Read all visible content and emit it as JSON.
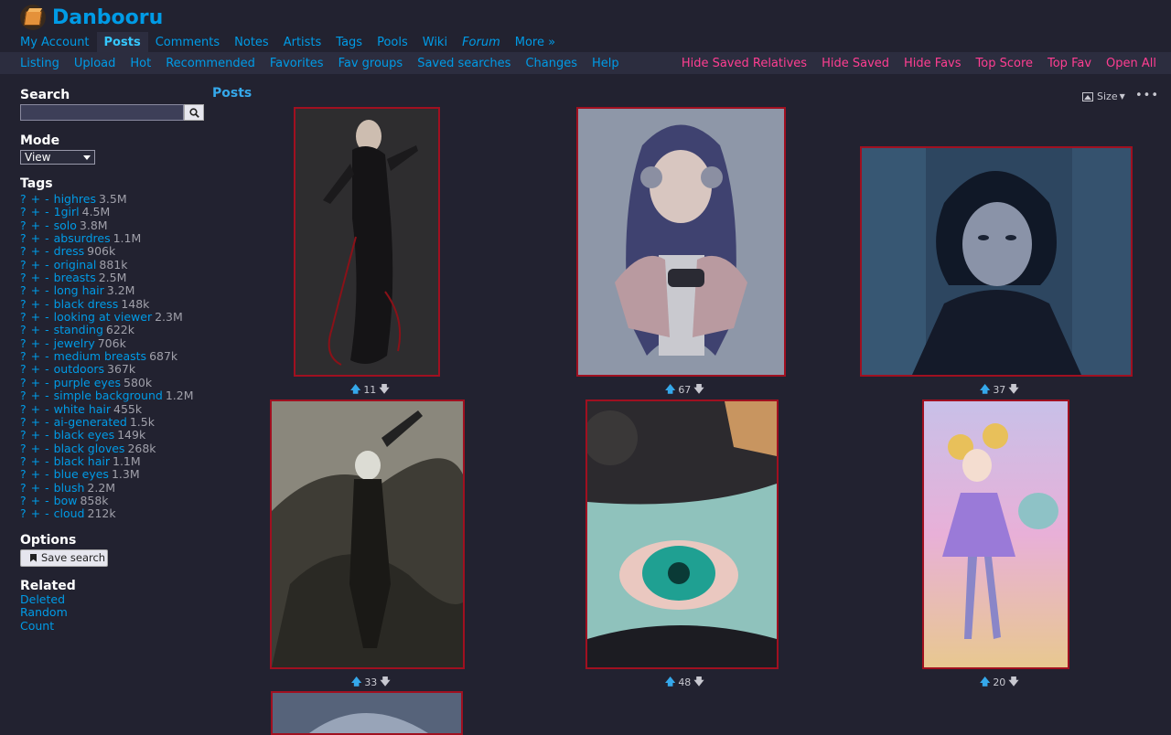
{
  "site": {
    "name": "Danbooru"
  },
  "main_menu": [
    {
      "label": "My Account"
    },
    {
      "label": "Posts",
      "active": true
    },
    {
      "label": "Comments"
    },
    {
      "label": "Notes"
    },
    {
      "label": "Artists"
    },
    {
      "label": "Tags"
    },
    {
      "label": "Pools"
    },
    {
      "label": "Wiki"
    },
    {
      "label": "Forum"
    },
    {
      "label": "More »"
    }
  ],
  "sub_menu_left": [
    {
      "label": "Listing"
    },
    {
      "label": "Upload"
    },
    {
      "label": "Hot"
    },
    {
      "label": "Recommended"
    },
    {
      "label": "Favorites"
    },
    {
      "label": "Fav groups"
    },
    {
      "label": "Saved searches"
    },
    {
      "label": "Changes"
    },
    {
      "label": "Help"
    }
  ],
  "sub_menu_right": [
    {
      "label": "Hide Saved Relatives"
    },
    {
      "label": "Hide Saved"
    },
    {
      "label": "Hide Favs"
    },
    {
      "label": "Top Score"
    },
    {
      "label": "Top Fav"
    },
    {
      "label": "Open All"
    }
  ],
  "sidebar": {
    "search_heading": "Search",
    "search_value": "",
    "mode_heading": "Mode",
    "mode_value": "View",
    "tags_heading": "Tags",
    "tags": [
      {
        "name": "highres",
        "count": "3.5M",
        "category": "meta"
      },
      {
        "name": "1girl",
        "count": "4.5M",
        "category": "general"
      },
      {
        "name": "solo",
        "count": "3.8M",
        "category": "general"
      },
      {
        "name": "absurdres",
        "count": "1.1M",
        "category": "meta"
      },
      {
        "name": "dress",
        "count": "906k",
        "category": "general"
      },
      {
        "name": "original",
        "count": "881k",
        "category": "copyright"
      },
      {
        "name": "breasts",
        "count": "2.5M",
        "category": "general"
      },
      {
        "name": "long hair",
        "count": "3.2M",
        "category": "general"
      },
      {
        "name": "black dress",
        "count": "148k",
        "category": "general"
      },
      {
        "name": "looking at viewer",
        "count": "2.3M",
        "category": "general"
      },
      {
        "name": "standing",
        "count": "622k",
        "category": "general"
      },
      {
        "name": "jewelry",
        "count": "706k",
        "category": "general"
      },
      {
        "name": "medium breasts",
        "count": "687k",
        "category": "general"
      },
      {
        "name": "outdoors",
        "count": "367k",
        "category": "general"
      },
      {
        "name": "purple eyes",
        "count": "580k",
        "category": "general"
      },
      {
        "name": "simple background",
        "count": "1.2M",
        "category": "general"
      },
      {
        "name": "white hair",
        "count": "455k",
        "category": "general"
      },
      {
        "name": "ai-generated",
        "count": "1.5k",
        "category": "meta"
      },
      {
        "name": "black eyes",
        "count": "149k",
        "category": "general"
      },
      {
        "name": "black gloves",
        "count": "268k",
        "category": "general"
      },
      {
        "name": "black hair",
        "count": "1.1M",
        "category": "general"
      },
      {
        "name": "blue eyes",
        "count": "1.3M",
        "category": "general"
      },
      {
        "name": "blush",
        "count": "2.2M",
        "category": "general"
      },
      {
        "name": "bow",
        "count": "858k",
        "category": "general"
      },
      {
        "name": "cloud",
        "count": "212k",
        "category": "general"
      }
    ],
    "tag_controls": {
      "wiki": "?",
      "add": "+",
      "exclude": "-"
    },
    "options_heading": "Options",
    "save_search_label": "Save search",
    "related_heading": "Related",
    "related_links": [
      {
        "label": "Deleted"
      },
      {
        "label": "Random"
      },
      {
        "label": "Count"
      }
    ]
  },
  "posts": {
    "title": "Posts",
    "size_label": "Size",
    "more_label": "•••",
    "items": [
      {
        "score": "11",
        "art": "dark-figure"
      },
      {
        "score": "67",
        "art": "headphones-girl"
      },
      {
        "score": "37",
        "art": "dark-portrait"
      },
      {
        "score": "33",
        "art": "android-smoke"
      },
      {
        "score": "48",
        "art": "eye-closeup"
      },
      {
        "score": "20",
        "art": "pastel-girl"
      },
      {
        "score": "",
        "art": "partial"
      }
    ]
  },
  "colors": {
    "background": "#222230",
    "link": "#009be6",
    "pink_link": "#ff3e92",
    "meta_tag": "#fad27a",
    "copyright_tag": "#c797ff",
    "thumb_border": "#a01020"
  }
}
